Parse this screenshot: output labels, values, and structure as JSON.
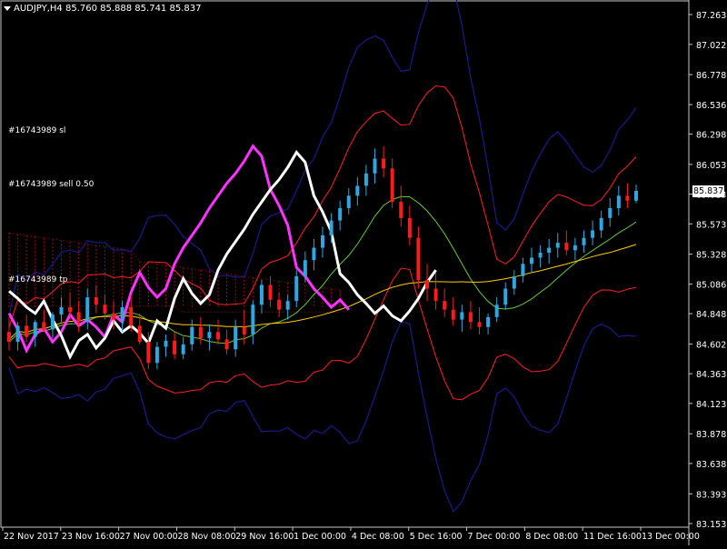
{
  "header": {
    "symbol_line": "AUDJPY,H4  85.760 85.888 85.741 85.837"
  },
  "objects": {
    "sl_label": "#16743989 sl",
    "sell_label": "#16743989 sell 0.50",
    "tp_label": "#16743989 tp"
  },
  "current_price": "85.837",
  "colors": {
    "background": "#000000",
    "bull_candle": "#2ea7e0",
    "bear_candle": "#ff1a1a",
    "ma_white": "#ffffff",
    "ma_magenta": "#ff33ff",
    "ma_yellow": "#ffcc00",
    "bollinger_red": "#ff2020",
    "bollinger_navy": "#1a1a8c",
    "bollinger_green": "#66cc33",
    "ichimoku_cloud": "#a01010"
  },
  "chart_data": {
    "type": "candlestick",
    "symbol": "AUDJPY",
    "timeframe": "H4",
    "y_axis_ticks": [
      "87.263",
      "87.022",
      "86.778",
      "86.536",
      "86.298",
      "86.053",
      "85.813",
      "85.573",
      "85.328",
      "85.086",
      "84.848",
      "84.602",
      "84.363",
      "84.123",
      "83.878",
      "83.638",
      "83.393",
      "83.153"
    ],
    "y_range": [
      83.153,
      87.263
    ],
    "x_axis_ticks": [
      "22 Nov 2017",
      "23 Nov 16:00",
      "27 Nov 00:00",
      "28 Nov 08:00",
      "29 Nov 16:00",
      "1 Dec 00:00",
      "4 Dec 08:00",
      "5 Dec 16:00",
      "7 Dec 00:00",
      "8 Dec 08:00",
      "11 Dec 16:00",
      "13 Dec 00:00"
    ],
    "candles": [
      [
        84.7,
        84.82,
        84.55,
        84.62
      ],
      [
        84.62,
        84.78,
        84.55,
        84.75
      ],
      [
        84.75,
        84.84,
        84.62,
        84.66
      ],
      [
        84.66,
        84.8,
        84.58,
        84.78
      ],
      [
        84.78,
        84.88,
        84.7,
        84.72
      ],
      [
        84.72,
        84.86,
        84.65,
        84.84
      ],
      [
        84.84,
        84.98,
        84.78,
        84.9
      ],
      [
        84.9,
        85.02,
        84.8,
        84.86
      ],
      [
        84.86,
        84.95,
        84.7,
        84.78
      ],
      [
        84.78,
        85.05,
        84.72,
        84.98
      ],
      [
        84.98,
        85.08,
        84.85,
        84.92
      ],
      [
        84.92,
        85.0,
        84.8,
        84.85
      ],
      [
        84.85,
        84.95,
        84.72,
        84.8
      ],
      [
        84.8,
        84.95,
        84.7,
        84.9
      ],
      [
        84.9,
        85.0,
        84.7,
        84.75
      ],
      [
        84.75,
        84.85,
        84.6,
        84.62
      ],
      [
        84.62,
        84.7,
        84.4,
        84.45
      ],
      [
        84.45,
        84.62,
        84.4,
        84.58
      ],
      [
        84.58,
        84.68,
        84.5,
        84.63
      ],
      [
        84.63,
        84.7,
        84.48,
        84.52
      ],
      [
        84.52,
        84.66,
        84.48,
        84.6
      ],
      [
        84.6,
        84.8,
        84.55,
        84.74
      ],
      [
        84.74,
        84.82,
        84.6,
        84.65
      ],
      [
        84.65,
        84.76,
        84.55,
        84.7
      ],
      [
        84.7,
        84.8,
        84.6,
        84.64
      ],
      [
        84.64,
        84.72,
        84.52,
        84.56
      ],
      [
        84.56,
        84.8,
        84.5,
        84.74
      ],
      [
        84.74,
        84.88,
        84.6,
        84.68
      ],
      [
        84.68,
        84.95,
        84.6,
        84.92
      ],
      [
        84.92,
        85.12,
        84.85,
        85.08
      ],
      [
        85.08,
        85.15,
        84.9,
        84.96
      ],
      [
        84.96,
        85.02,
        84.82,
        84.88
      ],
      [
        84.88,
        85.0,
        84.8,
        84.95
      ],
      [
        84.95,
        85.2,
        84.9,
        85.15
      ],
      [
        85.15,
        85.35,
        85.1,
        85.28
      ],
      [
        85.28,
        85.45,
        85.2,
        85.38
      ],
      [
        85.38,
        85.55,
        85.3,
        85.48
      ],
      [
        85.48,
        85.66,
        85.42,
        85.6
      ],
      [
        85.6,
        85.76,
        85.52,
        85.7
      ],
      [
        85.7,
        85.86,
        85.65,
        85.8
      ],
      [
        85.8,
        85.95,
        85.72,
        85.88
      ],
      [
        85.88,
        86.05,
        85.8,
        85.98
      ],
      [
        85.98,
        86.18,
        85.9,
        86.1
      ],
      [
        86.1,
        86.2,
        85.95,
        86.02
      ],
      [
        86.02,
        86.1,
        85.7,
        85.75
      ],
      [
        85.75,
        85.88,
        85.55,
        85.62
      ],
      [
        85.62,
        85.72,
        85.4,
        85.46
      ],
      [
        85.46,
        85.55,
        85.05,
        85.12
      ],
      [
        85.12,
        85.25,
        84.95,
        85.05
      ],
      [
        85.05,
        85.18,
        84.88,
        84.95
      ],
      [
        84.95,
        85.05,
        84.82,
        84.88
      ],
      [
        84.88,
        84.98,
        84.75,
        84.8
      ],
      [
        84.8,
        84.92,
        84.7,
        84.86
      ],
      [
        84.86,
        84.95,
        84.72,
        84.78
      ],
      [
        84.78,
        84.9,
        84.68,
        84.74
      ],
      [
        84.74,
        84.85,
        84.68,
        84.82
      ],
      [
        84.82,
        84.98,
        84.78,
        84.92
      ],
      [
        84.92,
        85.1,
        84.88,
        85.05
      ],
      [
        85.05,
        85.2,
        85.0,
        85.15
      ],
      [
        85.15,
        85.3,
        85.1,
        85.25
      ],
      [
        85.25,
        85.38,
        85.18,
        85.3
      ],
      [
        85.3,
        85.4,
        85.22,
        85.34
      ],
      [
        85.34,
        85.45,
        85.25,
        85.38
      ],
      [
        85.38,
        85.5,
        85.3,
        85.42
      ],
      [
        85.42,
        85.52,
        85.32,
        85.36
      ],
      [
        85.36,
        85.46,
        85.28,
        85.4
      ],
      [
        85.4,
        85.52,
        85.34,
        85.46
      ],
      [
        85.46,
        85.6,
        85.4,
        85.52
      ],
      [
        85.52,
        85.68,
        85.46,
        85.62
      ],
      [
        85.62,
        85.78,
        85.55,
        85.7
      ],
      [
        85.7,
        85.88,
        85.64,
        85.8
      ],
      [
        85.8,
        85.9,
        85.7,
        85.76
      ],
      [
        85.76,
        85.89,
        85.74,
        85.84
      ]
    ],
    "orders": [
      {
        "label": "#16743989 sl",
        "price": 86.3
      },
      {
        "label": "#16743989 sell 0.50",
        "price": 85.92
      },
      {
        "label": "#16743989 tp",
        "price": 85.06
      }
    ]
  }
}
